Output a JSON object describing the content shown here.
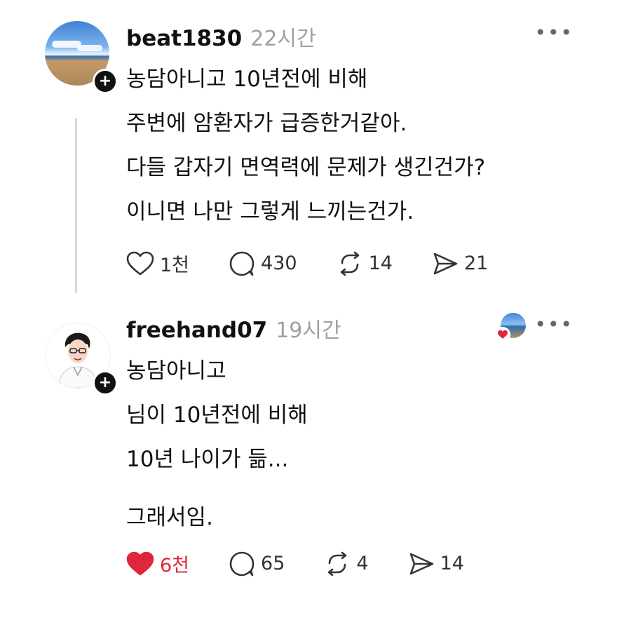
{
  "posts": [
    {
      "username": "beat1830",
      "time": "22시간",
      "more_icon": "more-dots-icon",
      "avatar_icon": "beach-photo-avatar",
      "lines": [
        "농담아니고 10년전에 비해",
        "주변에 암환자가 급증한거같아.",
        "다들 갑자기 면역력에 문제가 생긴건가?",
        "이니면 나만 그렇게 느끼는건가."
      ],
      "actions": {
        "like": {
          "icon": "heart-outline-icon",
          "count": "1천",
          "liked": false
        },
        "comment": {
          "icon": "comment-icon",
          "count": "430"
        },
        "repost": {
          "icon": "repost-icon",
          "count": "14"
        },
        "share": {
          "icon": "send-icon",
          "count": "21"
        }
      }
    },
    {
      "username": "freehand07",
      "time": "19시간",
      "more_icon": "more-dots-icon",
      "avatar_icon": "drawn-person-avatar",
      "lines": [
        "농담아니고",
        "님이 10년전에 비해",
        "10년 나이가 듦..."
      ],
      "extra_line": "그래서임.",
      "actions": {
        "like": {
          "icon": "heart-filled-icon",
          "count": "6천",
          "liked": true
        },
        "comment": {
          "icon": "comment-icon",
          "count": "65"
        },
        "repost": {
          "icon": "repost-icon",
          "count": "4"
        },
        "share": {
          "icon": "send-icon",
          "count": "14"
        }
      }
    }
  ],
  "colors": {
    "like_active": "#e0263a",
    "muted": "#a0a0a0",
    "text": "#111111"
  }
}
